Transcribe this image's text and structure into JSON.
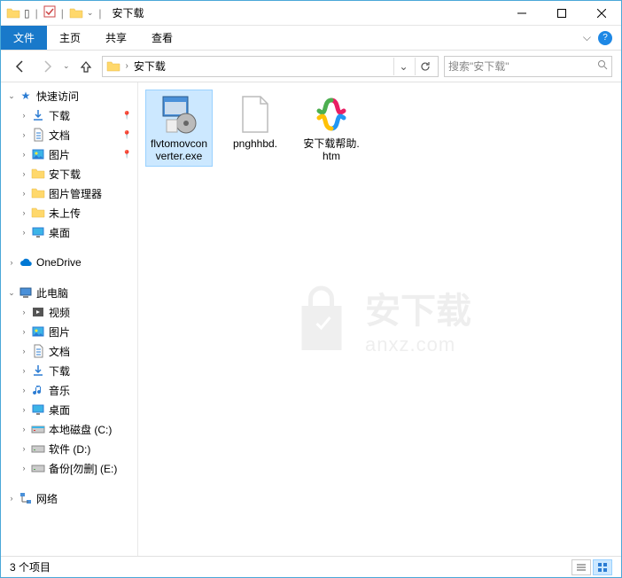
{
  "titlebar": {
    "title": "安下载"
  },
  "ribbon": {
    "file": "文件",
    "home": "主页",
    "share": "共享",
    "view": "查看"
  },
  "breadcrumb": {
    "current": "安下载"
  },
  "search": {
    "placeholder": "搜索\"安下载\""
  },
  "sidebar": {
    "quickaccess": "快速访问",
    "qa_items": [
      {
        "label": "下载",
        "pinned": true,
        "icon": "download"
      },
      {
        "label": "文档",
        "pinned": true,
        "icon": "document"
      },
      {
        "label": "图片",
        "pinned": true,
        "icon": "pictures"
      },
      {
        "label": "安下载",
        "pinned": false,
        "icon": "folder"
      },
      {
        "label": "图片管理器",
        "pinned": false,
        "icon": "folder"
      },
      {
        "label": "未上传",
        "pinned": false,
        "icon": "folder"
      },
      {
        "label": "桌面",
        "pinned": false,
        "icon": "desktop"
      }
    ],
    "onedrive": "OneDrive",
    "thispc": "此电脑",
    "pc_items": [
      {
        "label": "视频",
        "icon": "video"
      },
      {
        "label": "图片",
        "icon": "pictures"
      },
      {
        "label": "文档",
        "icon": "document"
      },
      {
        "label": "下载",
        "icon": "download"
      },
      {
        "label": "音乐",
        "icon": "music"
      },
      {
        "label": "桌面",
        "icon": "desktop"
      },
      {
        "label": "本地磁盘 (C:)",
        "icon": "drive-c"
      },
      {
        "label": "软件 (D:)",
        "icon": "drive"
      },
      {
        "label": "备份[勿删] (E:)",
        "icon": "drive"
      }
    ],
    "network": "网络"
  },
  "files": [
    {
      "name": "flvtomovconverter.exe",
      "type": "exe",
      "selected": true
    },
    {
      "name": "pnghhbd.",
      "type": "file",
      "selected": false
    },
    {
      "name": "安下载帮助.htm",
      "type": "htm",
      "selected": false
    }
  ],
  "watermark": {
    "cn": "安下载",
    "en": "anxz.com"
  },
  "statusbar": {
    "count": "3 个项目"
  }
}
